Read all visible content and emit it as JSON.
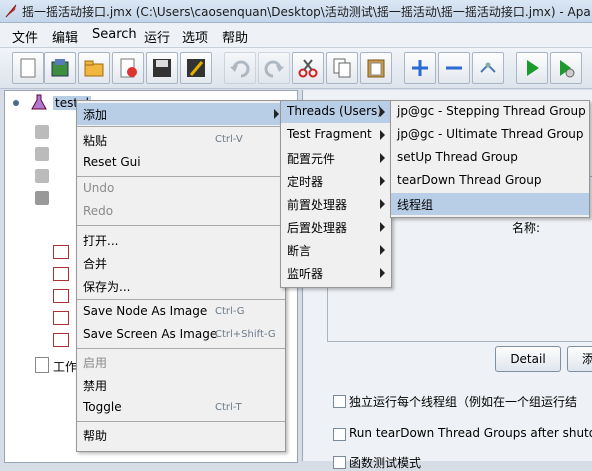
{
  "window": {
    "title": "摇一摇活动接口.jmx (C:\\Users\\caosenquan\\Desktop\\活动测试\\摇一摇活动\\摇一摇活动接口.jmx) - Apa"
  },
  "menubar": {
    "items": [
      "文件",
      "编辑",
      "Search",
      "运行",
      "选项",
      "帮助"
    ]
  },
  "toolbar": {
    "icons": [
      "new-icon",
      "templates-icon",
      "open-icon",
      "close-icon",
      "save-icon",
      "save-as-icon",
      "undo-icon",
      "redo-icon",
      "cut-icon",
      "copy-icon",
      "paste-icon",
      "expand-icon",
      "collapse-icon",
      "toggle-icon",
      "start-icon",
      "start-no-pause-icon"
    ]
  },
  "tree": {
    "root_label": "testpl",
    "workbench_label": "工作"
  },
  "context_menu": {
    "items": [
      {
        "label": "添加",
        "shortcut": "",
        "submenu": true,
        "highlighted": true,
        "disabled": false
      },
      {
        "label": "粘贴",
        "shortcut": "Ctrl-V",
        "submenu": false,
        "highlighted": false,
        "disabled": false
      },
      {
        "label": "Reset Gui",
        "shortcut": "",
        "submenu": false,
        "highlighted": false,
        "disabled": false
      },
      {
        "label": "Undo",
        "shortcut": "",
        "submenu": false,
        "highlighted": false,
        "disabled": true
      },
      {
        "label": "Redo",
        "shortcut": "",
        "submenu": false,
        "highlighted": false,
        "disabled": true
      },
      {
        "label": "打开...",
        "shortcut": "",
        "submenu": false,
        "highlighted": false,
        "disabled": false
      },
      {
        "label": "合并",
        "shortcut": "",
        "submenu": false,
        "highlighted": false,
        "disabled": false
      },
      {
        "label": "保存为...",
        "shortcut": "",
        "submenu": false,
        "highlighted": false,
        "disabled": false
      },
      {
        "label": "Save Node As Image",
        "shortcut": "Ctrl-G",
        "submenu": false,
        "highlighted": false,
        "disabled": false
      },
      {
        "label": "Save Screen As Image",
        "shortcut": "Ctrl+Shift-G",
        "submenu": false,
        "highlighted": false,
        "disabled": false
      },
      {
        "label": "启用",
        "shortcut": "",
        "submenu": false,
        "highlighted": false,
        "disabled": true
      },
      {
        "label": "禁用",
        "shortcut": "",
        "submenu": false,
        "highlighted": false,
        "disabled": false
      },
      {
        "label": "Toggle",
        "shortcut": "Ctrl-T",
        "submenu": false,
        "highlighted": false,
        "disabled": false
      },
      {
        "label": "帮助",
        "shortcut": "",
        "submenu": false,
        "highlighted": false,
        "disabled": false
      }
    ]
  },
  "add_submenu": {
    "items": [
      {
        "label": "Threads (Users)",
        "highlighted": true
      },
      {
        "label": "Test Fragment",
        "highlighted": false
      },
      {
        "label": "配置元件",
        "highlighted": false
      },
      {
        "label": "定时器",
        "highlighted": false
      },
      {
        "label": "前置处理器",
        "highlighted": false
      },
      {
        "label": "后置处理器",
        "highlighted": false
      },
      {
        "label": "断言",
        "highlighted": false
      },
      {
        "label": "监听器",
        "highlighted": false
      }
    ]
  },
  "threads_submenu": {
    "items": [
      {
        "label": "jp@gc - Stepping Thread Group",
        "highlighted": false
      },
      {
        "label": "jp@gc - Ultimate Thread Group",
        "highlighted": false
      },
      {
        "label": "setUp Thread Group",
        "highlighted": false
      },
      {
        "label": "tearDown Thread Group",
        "highlighted": false
      },
      {
        "label": "线程组",
        "highlighted": true
      }
    ]
  },
  "right_panel": {
    "name_label": "名称:",
    "detail_button": "Detail",
    "add_button_partial": "添",
    "checkboxes": [
      "独立运行每个线程组（例如在一个组运行结",
      "Run tearDown Thread Groups after shutdov",
      "函数测试模式"
    ]
  }
}
